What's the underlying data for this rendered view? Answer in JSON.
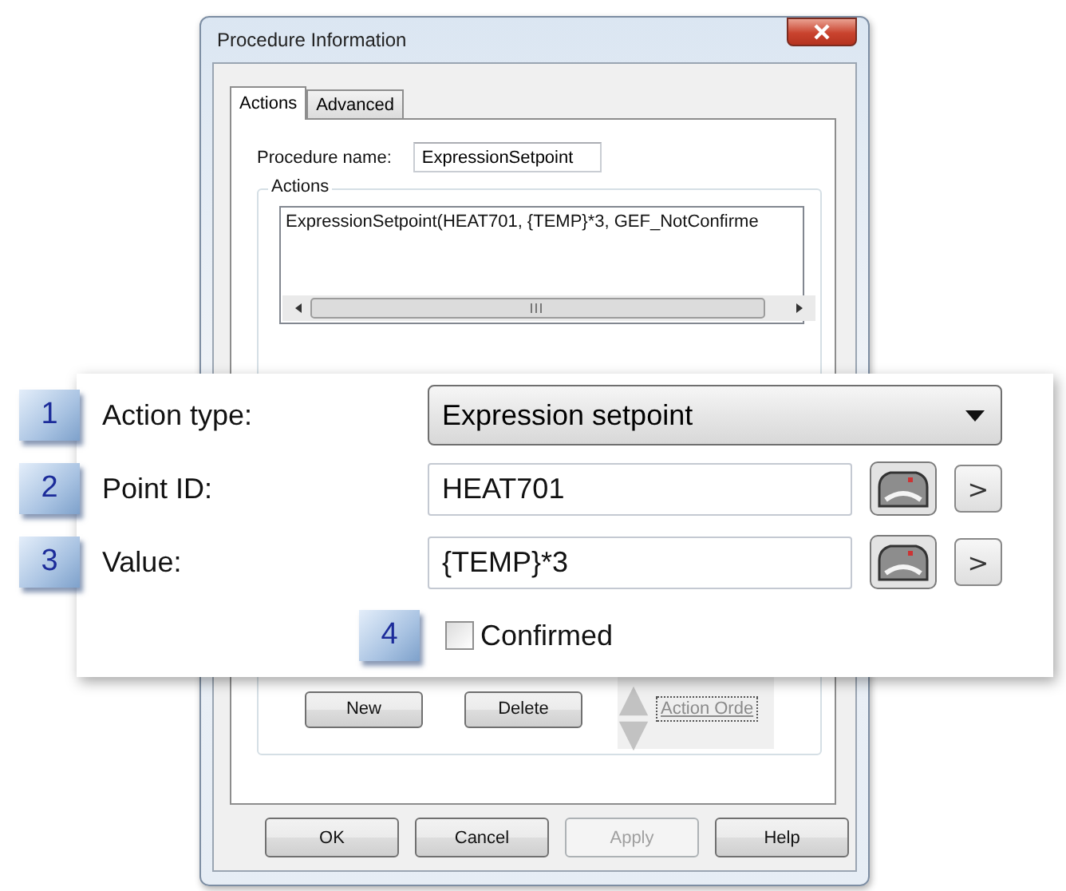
{
  "window": {
    "title": "Procedure Information"
  },
  "tabs": [
    {
      "label": "Actions",
      "selected": true
    },
    {
      "label": "Advanced",
      "selected": false
    }
  ],
  "procedure_name": {
    "label": "Procedure name:",
    "value": "ExpressionSetpoint"
  },
  "actions_group": {
    "title": "Actions",
    "list_items": [
      "ExpressionSetpoint(HEAT701, {TEMP}*3, GEF_NotConfirme"
    ],
    "buttons": [
      {
        "label": "New"
      },
      {
        "label": "Delete"
      }
    ],
    "order_button": "Action Orde"
  },
  "dialog_buttons": [
    {
      "label": "OK",
      "disabled": false
    },
    {
      "label": "Cancel",
      "disabled": false
    },
    {
      "label": "Apply",
      "disabled": true
    },
    {
      "label": "Help",
      "disabled": false
    }
  ],
  "callout": {
    "rows": [
      {
        "kind": "dropdown",
        "number": "1",
        "label": "Action type:",
        "value": "Expression setpoint"
      },
      {
        "kind": "point",
        "number": "2",
        "label": "Point ID:",
        "value": "HEAT701",
        "arrow": ">"
      },
      {
        "kind": "point",
        "number": "3",
        "label": "Value:",
        "value": "{TEMP}*3",
        "arrow": ">"
      },
      {
        "kind": "checkbox",
        "number": "4",
        "label": "Confirmed",
        "checked": false
      }
    ]
  }
}
